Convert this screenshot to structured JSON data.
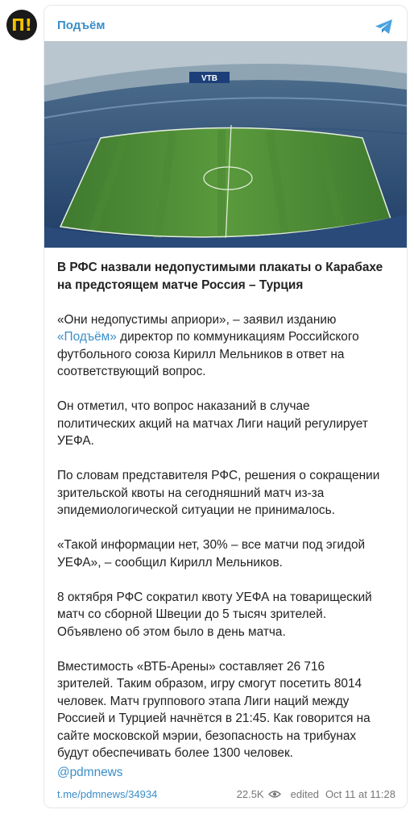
{
  "channel": {
    "name": "Подъём",
    "avatar_text": "П!",
    "handle": "@pdmnews"
  },
  "post": {
    "headline_line1": "В РФС назвали недопустимыми плакаты о Карабахе",
    "headline_line2": "на предстоящем матче Россия – Турция",
    "p1_line1": "«Они недопустимы априори», – заявил изданию",
    "p1_link": "«Подъём»",
    "p1_line2_rest": " директор по коммуникациям Российского",
    "p1_line3": "футбольного союза Кирилл Мельников в ответ на",
    "p1_line4": "соответствующий вопрос.",
    "p2_line1": "Он отметил, что вопрос наказаний в случае",
    "p2_line2": "политических акций на матчах Лиги наций регулирует",
    "p2_line3": "УЕФА.",
    "p3_line1": "По словам представителя РФС, решения о сокращении",
    "p3_line2": "зрительской квоты на сегодняшний матч из-за",
    "p3_line3": "эпидемиологической ситуации не принималось.",
    "p4_line1": "«Такой информации нет, 30% – все матчи под эгидой",
    "p4_line2": "УЕФА», – сообщил Кирилл Мельников.",
    "p5_line1": "8 октября РФС сократил квоту УЕФА на товарищеский",
    "p5_line2": "матч со сборной Швеции до 5 тысяч зрителей.",
    "p5_line3": "Объявлено об этом было в день матча.",
    "p6_line1": "Вместимость «ВТБ-Арены» составляет 26 716",
    "p6_line2": "зрителей. Таким образом, игру смогут посетить 8014",
    "p6_line3": "человек. Матч группового этапа Лиги наций между",
    "p6_line4": "Россией и Турцией начнётся в 21:45. Как говорится на",
    "p6_line5": "сайте московской мэрии, безопасность на трибунах",
    "p6_line6": "будут обеспечивать более 1300 человек."
  },
  "footer": {
    "post_link": "t.me/pdmnews/34934",
    "views": "22.5K",
    "edited": "edited",
    "timestamp": "Oct 11 at 11:28"
  },
  "image": {
    "logo_text": "VTB"
  },
  "colors": {
    "accent": "#3a8ec9",
    "avatar_bg": "#1a1a1a",
    "avatar_fg": "#f2c200"
  }
}
